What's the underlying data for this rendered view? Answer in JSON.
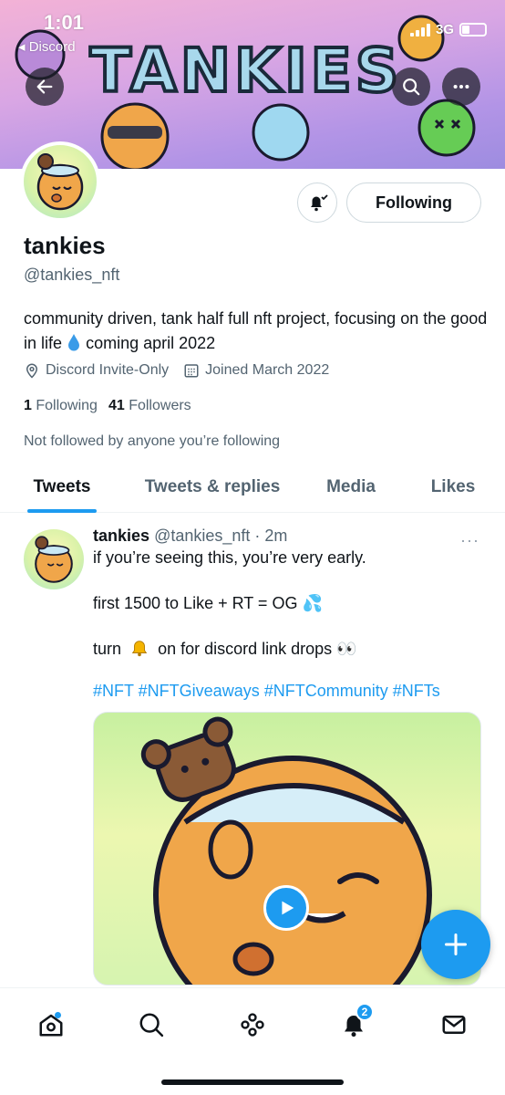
{
  "status_bar": {
    "time": "1:01",
    "back_app": "◂ Discord",
    "network": "3G"
  },
  "banner": {
    "logo_text": "TANKIES"
  },
  "profile": {
    "display_name": "tankies",
    "handle": "@tankies_nft",
    "bio_part1": "community driven, tank half full nft project, focusing on the good in life",
    "bio_part2": "coming april 2022",
    "location": "Discord Invite-Only",
    "joined": "Joined March 2022",
    "following_count": "1",
    "following_label": "Following",
    "followers_count": "41",
    "followers_label": "Followers",
    "not_followed_text": "Not followed by anyone you’re following",
    "follow_button_label": "Following"
  },
  "tabs": [
    {
      "label": "Tweets",
      "active": true
    },
    {
      "label": "Tweets & replies",
      "active": false
    },
    {
      "label": "Media",
      "active": false
    },
    {
      "label": "Likes",
      "active": false
    }
  ],
  "tweet": {
    "author_name": "tankies",
    "author_handle": "@tankies_nft · 2m",
    "line1": "if you’re seeing this, you’re very early.",
    "line2": "first 1500 to Like + RT = OG 💦",
    "line3_pre": "turn",
    "line3_post": "on for discord link drops 👀",
    "hashtags": "#NFT #NFTGiveaways #NFTCommunity #NFTs",
    "more": "···"
  },
  "bottom_nav": {
    "notifications_badge": "2"
  },
  "colors": {
    "accent": "#1d9bf0",
    "text_primary": "#0f1419",
    "text_secondary": "#536471"
  },
  "icons": [
    "back-arrow-icon",
    "search-icon",
    "more-icon",
    "bell-icon",
    "location-icon",
    "calendar-icon",
    "drop-icon",
    "play-icon",
    "compose-plus-icon",
    "home-icon",
    "explore-icon",
    "spaces-icon",
    "notifications-icon",
    "messages-icon"
  ]
}
